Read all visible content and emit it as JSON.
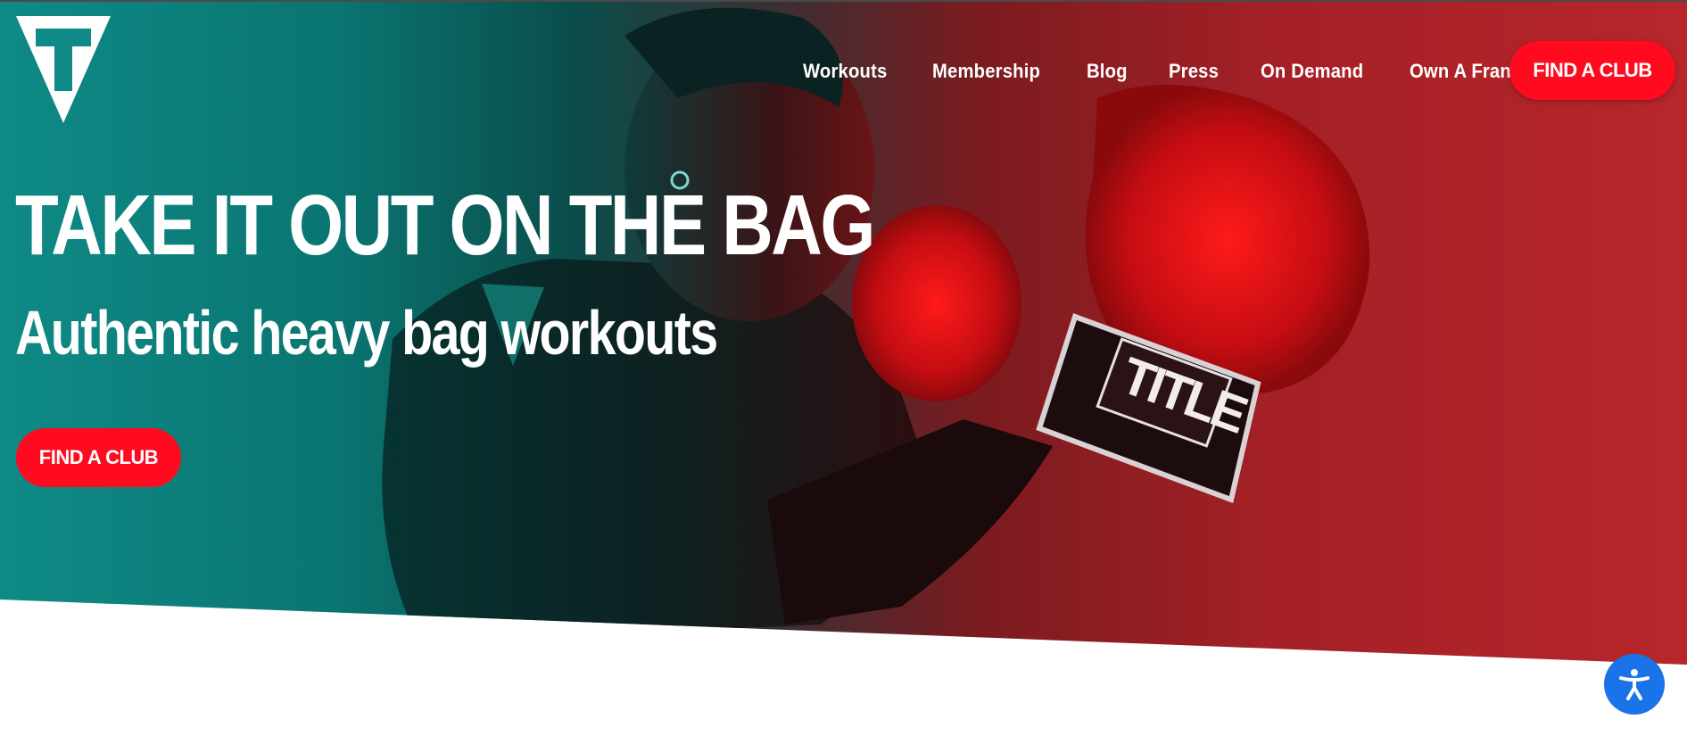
{
  "colors": {
    "brand_red": "#ff0a1f",
    "teal": "#0f8a86",
    "accessibility_blue": "#1a73e8"
  },
  "logo": {
    "icon": "title-boxing-logo-icon"
  },
  "nav": {
    "items": [
      {
        "label": "Workouts"
      },
      {
        "label": "Membership"
      },
      {
        "label": "Blog"
      },
      {
        "label": "Press"
      },
      {
        "label": "On Demand"
      },
      {
        "label": "Own A Franchise"
      }
    ],
    "cta_label": "FIND A CLUB"
  },
  "hero": {
    "headline": "TAKE IT OUT ON THE BAG",
    "subheadline": "Authentic heavy bag workouts",
    "cta_label": "FIND A CLUB",
    "image": "boxer-with-red-gloves-photo",
    "glove_text": "TITLE"
  },
  "accessibility": {
    "icon": "accessibility-person-icon"
  }
}
